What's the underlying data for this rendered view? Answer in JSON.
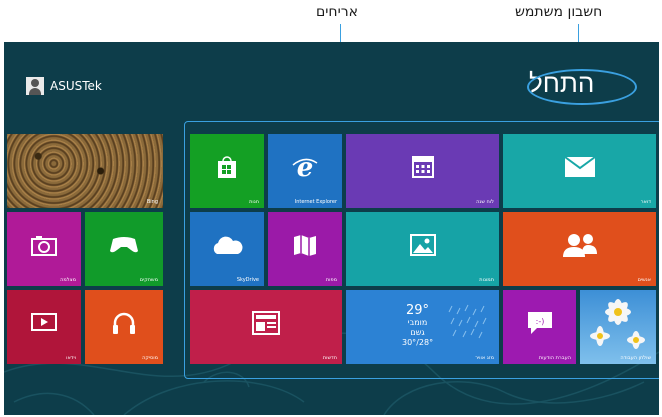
{
  "callouts": {
    "user_account": "חשבון משתמש",
    "tiles": "אריחים"
  },
  "start": {
    "title": "התחל",
    "user_name": "ASUSTek"
  },
  "tiles": {
    "bing": "Bing",
    "camera": "מצלמה",
    "games": "משחקים",
    "video": "וידאו",
    "music": "מוסיקה",
    "store": "חנות",
    "ie": "Internet Explorer",
    "calendar": "לוח שנה",
    "mail": "דואר",
    "skydrive": "SkyDrive",
    "maps": "מפות",
    "photos": "תמונות",
    "people": "אנשים",
    "news": "חדשות",
    "weather": {
      "label": "מזג אוויר",
      "temp": "29°",
      "city": "מומבי",
      "condition": "גשם",
      "range": "28°/30°"
    },
    "messaging": "העברת הודעות",
    "desktop": "שולחן העבודה"
  },
  "colors": {
    "background": "#0d3d4a",
    "callout_line": "#3aa0e0",
    "store": "#14a024",
    "ie": "#1f72c2",
    "calendar": "#6a3ab4",
    "mail": "#18a7a7",
    "maps": "#9b1aa8",
    "photos": "#16a3a6",
    "people": "#e04f1c",
    "news": "#c01f4a",
    "weather": "#2c82d4",
    "messaging": "#9d1ab0",
    "camera": "#b01a98",
    "games": "#119b2a",
    "video": "#b0153a",
    "music": "#e04f1c"
  }
}
